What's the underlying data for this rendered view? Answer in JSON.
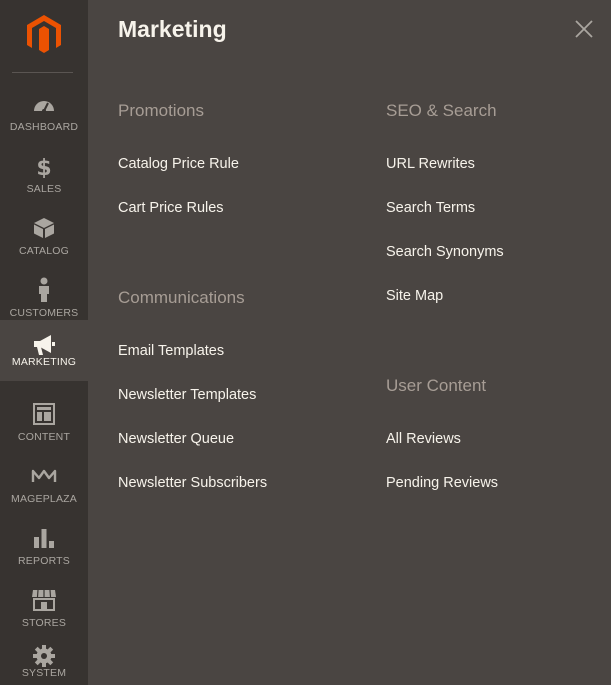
{
  "sidebar": {
    "items": [
      {
        "label": "DASHBOARD"
      },
      {
        "label": "SALES"
      },
      {
        "label": "CATALOG"
      },
      {
        "label": "CUSTOMERS"
      },
      {
        "label": "MARKETING"
      },
      {
        "label": "CONTENT"
      },
      {
        "label": "MAGEPLAZA"
      },
      {
        "label": "REPORTS"
      },
      {
        "label": "STORES"
      },
      {
        "label": "SYSTEM"
      }
    ],
    "active": "MARKETING"
  },
  "panel": {
    "title": "Marketing",
    "columns": [
      {
        "sections": [
          {
            "title": "Promotions",
            "links": [
              "Catalog Price Rule",
              "Cart Price Rules"
            ]
          },
          {
            "title": "Communications",
            "links": [
              "Email Templates",
              "Newsletter Templates",
              "Newsletter Queue",
              "Newsletter Subscribers"
            ]
          }
        ]
      },
      {
        "sections": [
          {
            "title": "SEO & Search",
            "links": [
              "URL Rewrites",
              "Search Terms",
              "Search Synonyms",
              "Site Map"
            ]
          },
          {
            "title": "User Content",
            "links": [
              "All Reviews",
              "Pending Reviews"
            ]
          }
        ]
      }
    ]
  },
  "colors": {
    "sidebar_bg": "#373330",
    "panel_bg": "#4a4542",
    "brand_orange": "#eb5202",
    "section_title": "#a79d95",
    "link_text": "#f7f3eb",
    "nav_label": "#aaa6a0"
  },
  "icons": {
    "logo": "magento-logo-icon",
    "close": "close-icon"
  }
}
